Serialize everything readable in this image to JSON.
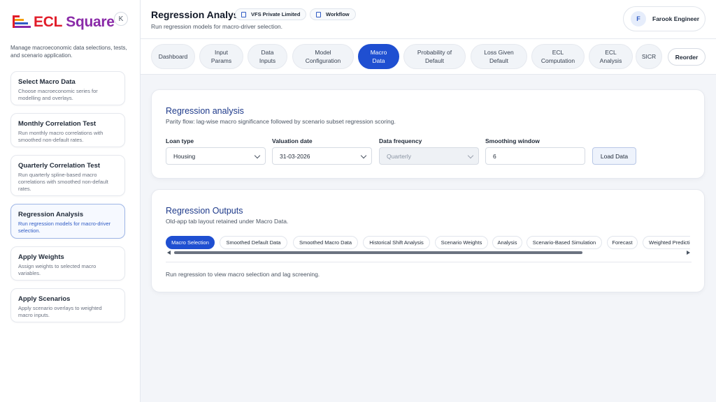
{
  "brand": {
    "ecl": "ECL",
    "square": " Square",
    "colors": [
      "#e11d2a",
      "#f59e0b",
      "#2f5bc4",
      "#8a2aa8"
    ]
  },
  "sidebar": {
    "collapse_label": "K",
    "description": "Manage macroeconomic data selections, tests, and scenario application.",
    "items": [
      {
        "title": "Select Macro Data",
        "desc": "Choose macroeconomic series for modelling and overlays."
      },
      {
        "title": "Monthly Correlation Test",
        "desc": "Run monthly macro correlations with smoothed non-default rates."
      },
      {
        "title": "Quarterly Correlation Test",
        "desc": "Run quarterly spline-based macro correlations with smoothed non-default rates."
      },
      {
        "title": "Regression Analysis",
        "desc": "Run regression models for macro-driver selection."
      },
      {
        "title": "Apply Weights",
        "desc": "Assign weights to selected macro variables."
      },
      {
        "title": "Apply Scenarios",
        "desc": "Apply scenario overlays to weighted macro inputs."
      }
    ]
  },
  "header": {
    "title": "Regression Analysis",
    "subtitle": "Run regression models for macro-driver selection.",
    "company": "VFS Private Limited",
    "workflow": "Workflow",
    "user_initial": "F",
    "user_name": "Farook Engineer"
  },
  "tabs": [
    {
      "label": "Dashboard"
    },
    {
      "label": "Input Params"
    },
    {
      "label": "Data Inputs"
    },
    {
      "label": "Model Configuration"
    },
    {
      "label": "Macro Data"
    },
    {
      "label": "Probability of Default"
    },
    {
      "label": "Loss Given Default"
    },
    {
      "label": "ECL Computation"
    },
    {
      "label": "ECL Analysis"
    },
    {
      "label": "SICR"
    }
  ],
  "reorder_label": "Reorder",
  "analysis": {
    "title": "Regression analysis",
    "subtitle": "Parity flow: lag-wise macro significance followed by scenario subset regression scoring.",
    "loan_type_label": "Loan type",
    "loan_type_value": "Housing",
    "valuation_date_label": "Valuation date",
    "valuation_date_value": "31-03-2026",
    "data_frequency_label": "Data frequency",
    "data_frequency_value": "Quarterly",
    "smoothing_label": "Smoothing window",
    "smoothing_value": "6",
    "load_label": "Load Data"
  },
  "outputs": {
    "title": "Regression Outputs",
    "subtitle": "Old-app tab layout retained under Macro Data.",
    "subtabs": [
      {
        "label": "Macro Selection"
      },
      {
        "label": "Smoothed Default Data"
      },
      {
        "label": "Smoothed Macro Data"
      },
      {
        "label": "Historical Shift Analysis"
      },
      {
        "label": "Scenario Weights"
      },
      {
        "label": "Analysis"
      },
      {
        "label": "Scenario-Based Simulation"
      },
      {
        "label": "Forecast"
      },
      {
        "label": "Weighted Predictions"
      }
    ],
    "empty_message": "Run regression to view macro selection and lag screening."
  }
}
